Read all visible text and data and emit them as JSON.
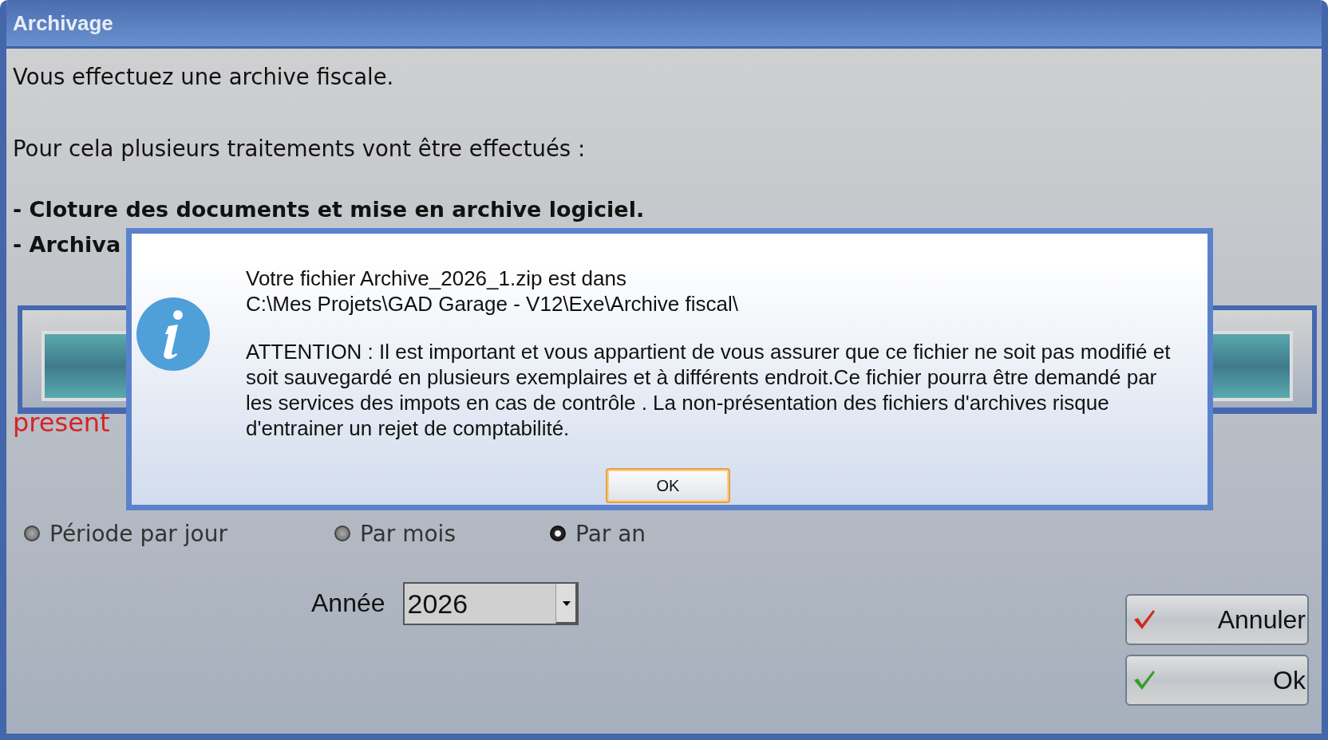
{
  "window": {
    "title": "Archivage"
  },
  "intro": [
    "Vous effectuez une archive fiscale.",
    "Pour cela plusieurs traitements vont être effectués :"
  ],
  "steps": [
    "- Cloture des documents et mise en archive logiciel.",
    "- Archiva"
  ],
  "progress": {
    "level": 1
  },
  "warning_fragment": "present",
  "periods": [
    {
      "label": "Période par jour",
      "selected": false
    },
    {
      "label": "Par mois",
      "selected": false
    },
    {
      "label": "Par an",
      "selected": true
    }
  ],
  "year": {
    "label": "Année",
    "value": "2026"
  },
  "buttons": [
    {
      "label": "Annuler",
      "kind": "cancel"
    },
    {
      "label": "Ok",
      "kind": "ok"
    }
  ],
  "message_box": {
    "path_lines": [
      "Votre  fichier Archive_2026_1.zip est  dans",
      "C:\\Mes Projets\\GAD Garage - V12\\Exe\\Archive fiscal\\"
    ],
    "warning_lines": [
      "ATTENTION : Il est important et vous appartient de vous assurer que ce fichier ne soit pas modifié et",
      "soit sauvegardé en plusieurs exemplaires et à différents endroit.Ce fichier pourra être demandé par",
      "les services des impots en cas de contrôle . La non-présentation des fichiers d'archives risque",
      "d'entrainer un rejet de comptabilité."
    ],
    "button": "OK"
  }
}
